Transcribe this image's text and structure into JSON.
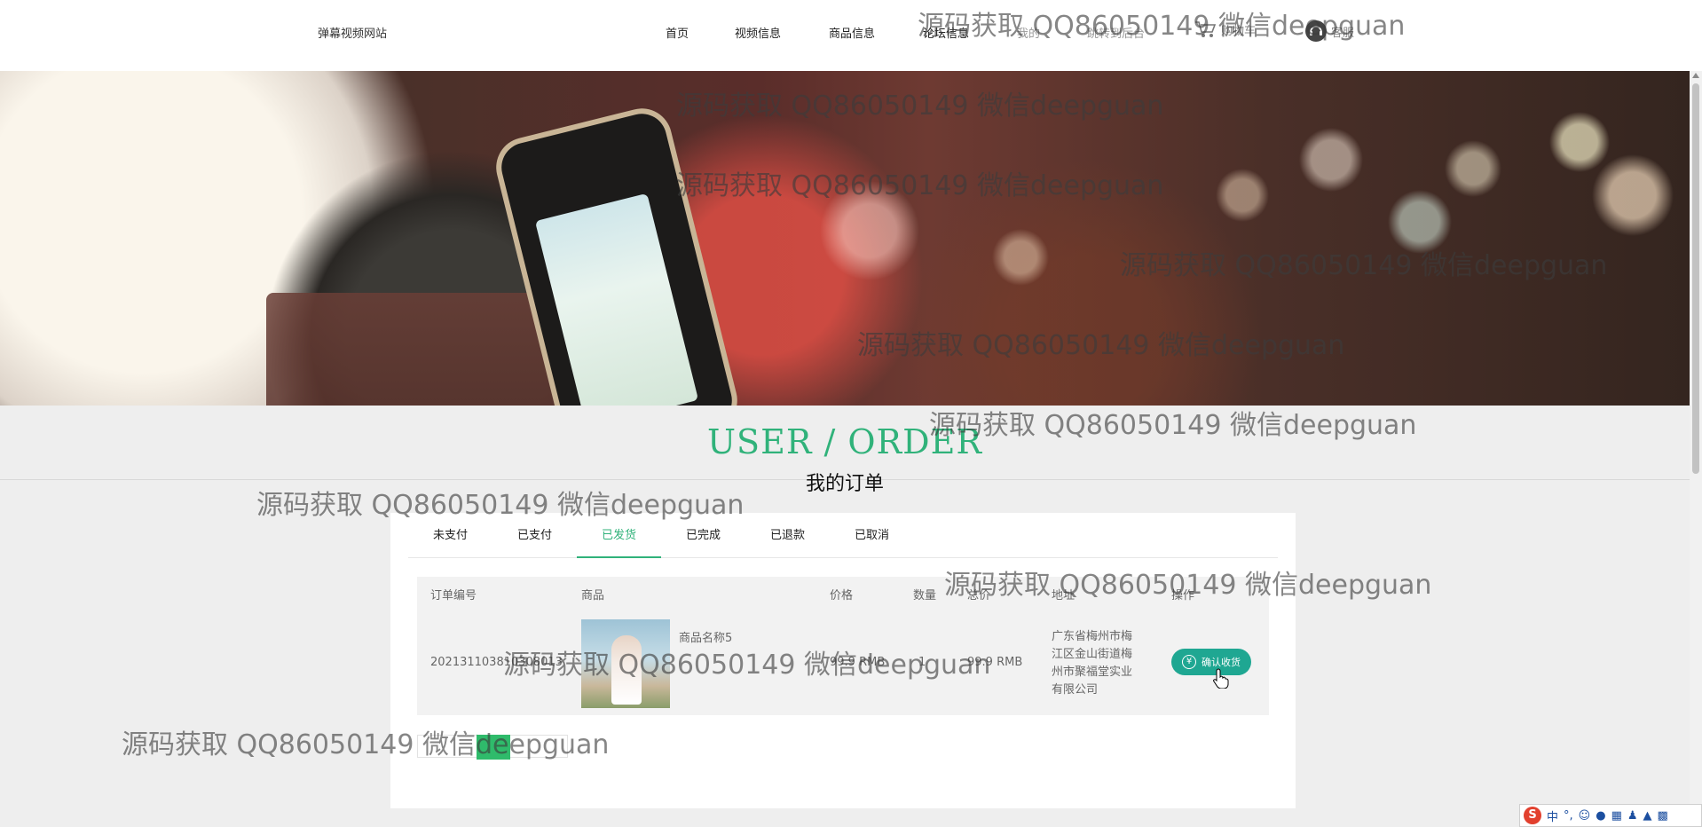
{
  "header": {
    "brand": "弹幕视频网站",
    "nav": [
      {
        "label": "首页"
      },
      {
        "label": "视频信息"
      },
      {
        "label": "商品信息"
      },
      {
        "label": "论坛信息"
      },
      {
        "label": "我的"
      },
      {
        "label": "跳转到后台"
      }
    ],
    "cart": {
      "label": "购物车",
      "icon": "cart-icon"
    },
    "service": {
      "label": "客服",
      "icon": "headset-icon"
    }
  },
  "section": {
    "title": "USER / ORDER",
    "subtitle": "我的订单"
  },
  "tabs": [
    {
      "label": "未支付",
      "active": false
    },
    {
      "label": "已支付",
      "active": false
    },
    {
      "label": "已发货",
      "active": true
    },
    {
      "label": "已完成",
      "active": false
    },
    {
      "label": "已退款",
      "active": false
    },
    {
      "label": "已取消",
      "active": false
    }
  ],
  "table": {
    "headers": [
      "订单编号",
      "商品",
      "价格",
      "数量",
      "总价",
      "地址",
      "操作"
    ],
    "rows": [
      {
        "order_no": "202131103810308013",
        "product_name": "商品名称5",
        "price": "99.9 RMB",
        "quantity": "1",
        "total": "99.9 RMB",
        "address": [
          "广东省梅州市梅",
          "江区金山街道梅",
          "州市聚福堂实业",
          "有限公司"
        ],
        "action": "确认收货"
      }
    ]
  },
  "pagination": {
    "current": "1"
  },
  "watermark": "源码获取 QQ86050149 微信deepguan",
  "ime": {
    "logo": "S",
    "lang": "中"
  },
  "colors": {
    "accent": "#30b27a",
    "button": "#1fa792",
    "pager": "#2fbb6b"
  }
}
